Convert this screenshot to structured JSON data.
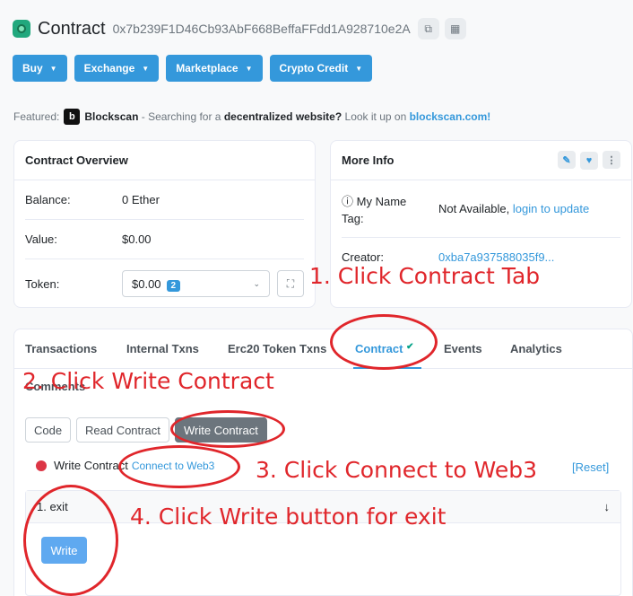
{
  "header": {
    "title": "Contract",
    "address": "0x7b239F1D46Cb93AbF668BeffaFFdd1A928710e2A"
  },
  "nav_buttons": [
    {
      "label": "Buy"
    },
    {
      "label": "Exchange"
    },
    {
      "label": "Marketplace"
    },
    {
      "label": "Crypto Credit"
    }
  ],
  "featured": {
    "prefix": "Featured:",
    "brand": "Blockscan",
    "brand_letter": "b",
    "text1": "- Searching for a",
    "highlight": "decentralized website?",
    "text2": "Look it up on",
    "link": "blockscan.com!"
  },
  "overview": {
    "title": "Contract Overview",
    "balance_label": "Balance:",
    "balance_value": "0 Ether",
    "value_label": "Value:",
    "value_value": "$0.00",
    "token_label": "Token:",
    "token_value": "$0.00",
    "token_count": "2"
  },
  "moreinfo": {
    "title": "More Info",
    "nametag_label_1": "My Name",
    "nametag_label_2": "Tag:",
    "nametag_value": "Not Available,",
    "nametag_link": "login to update",
    "creator_label": "Creator:",
    "creator_value": "0xba7a937588035f9..."
  },
  "tabs": [
    {
      "label": "Transactions"
    },
    {
      "label": "Internal Txns"
    },
    {
      "label": "Erc20 Token Txns"
    },
    {
      "label": "Contract"
    },
    {
      "label": "Events"
    },
    {
      "label": "Analytics"
    }
  ],
  "comments_tab": "Comments",
  "sub_buttons": {
    "code": "Code",
    "read": "Read Contract",
    "write": "Write Contract"
  },
  "write": {
    "status": "Write Contract",
    "connect": "Connect to Web3",
    "reset": "[Reset]",
    "function": "1. exit",
    "button": "Write"
  },
  "annotations": {
    "a1": "1. Click Contract Tab",
    "a2": "2. Click Write Contract",
    "a3": "3. Click Connect to Web3",
    "a4": "4. Click Write button for exit"
  },
  "colors": {
    "accent": "#3498db",
    "annotation": "#e0262b",
    "status_dot": "#dc3545"
  }
}
